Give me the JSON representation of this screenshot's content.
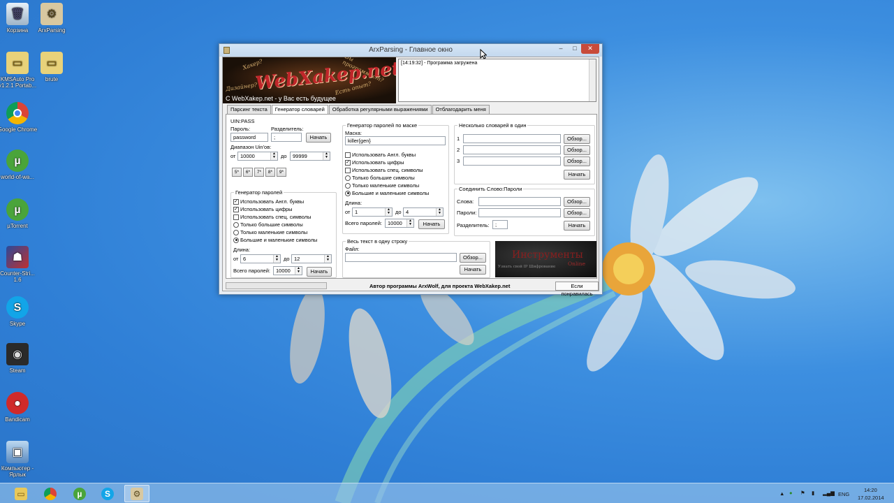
{
  "desktop_icons": [
    {
      "label": "Корзина"
    },
    {
      "label": "ArxParsing"
    },
    {
      "label": "KMSAuto Pro v1.2.1 Portab..."
    },
    {
      "label": "brute"
    },
    {
      "label": "Google Chrome"
    },
    {
      "label": "world-of-wa..."
    },
    {
      "label": "µTorrent"
    },
    {
      "label": "Counter-Stri... 1.6"
    },
    {
      "label": "Skype"
    },
    {
      "label": "Steam"
    },
    {
      "label": "Bandicam"
    },
    {
      "label": "Компьютер - Ярлык"
    }
  ],
  "window": {
    "title": "ArxParsing - Главное окно",
    "minimize": "–",
    "maximize": "□",
    "close": "✕"
  },
  "banner": {
    "logo": "WebXakep.net",
    "deco1": "Хакер?",
    "deco2": "Вы программист?",
    "deco3": "Дизайнер?",
    "deco4": "Есть опыт?",
    "subtitle": "С WebXakep.net - у Вас есть будущее"
  },
  "log": {
    "line": "[14:19:32] - Программа загружена"
  },
  "tabs": [
    "Парсинг текста",
    "Генератор словарей",
    "Обработка регулярными выражениями",
    "Отблагодарить меня"
  ],
  "uinpass": {
    "title": "UIN:PASS",
    "password_label": "Пароль:",
    "password_value": "password",
    "separator_label": "Разделитель:",
    "separator_value": ";",
    "start": "Начать",
    "range_label": "Диапазон Uin'ов:",
    "from_label": "от",
    "from_value": "10000",
    "to_label": "до",
    "to_value": "99999",
    "digit_buttons": [
      "5*",
      "6*",
      "7*",
      "8*",
      "9*"
    ]
  },
  "passgen": {
    "title": "Генератор паролей",
    "options": [
      {
        "label": "Использовать Англ. буквы",
        "type": "check",
        "on": true
      },
      {
        "label": "Использовать цифры",
        "type": "check",
        "on": true
      },
      {
        "label": "Использовать спец. символы",
        "type": "check",
        "on": false
      },
      {
        "label": "Только большие символы",
        "type": "radio",
        "on": false
      },
      {
        "label": "Только маленькие символы",
        "type": "radio",
        "on": false
      },
      {
        "label": "Большие и маленькие символы",
        "type": "radio",
        "on": true
      }
    ],
    "length_label": "Длина:",
    "from_label": "от",
    "from_value": "6",
    "to_label": "до",
    "to_value": "12",
    "total_label": "Всего паролей:",
    "total_value": "10000",
    "start": "Начать"
  },
  "maskgen": {
    "title": "Генератор паролей по маске",
    "mask_label": "Маска:",
    "mask_value": "killer{gen}",
    "options": [
      {
        "label": "Использовать Англ. буквы",
        "type": "check",
        "on": false
      },
      {
        "label": "Использовать цифры",
        "type": "check",
        "on": true
      },
      {
        "label": "Использовать спец. символы",
        "type": "check",
        "on": false
      },
      {
        "label": "Только большие символы",
        "type": "radio",
        "on": false
      },
      {
        "label": "Только маленькие символы",
        "type": "radio",
        "on": false
      },
      {
        "label": "Большие и маленькие символы",
        "type": "radio",
        "on": true
      }
    ],
    "length_label": "Длина:",
    "from_label": "от",
    "from_value": "1",
    "to_label": "до",
    "to_value": "4",
    "total_label": "Всего паролей:",
    "total_value": "10000",
    "start": "Начать"
  },
  "oneline": {
    "title": "Весь текст в одну строку",
    "file_label": "Файл:",
    "browse": "Обзор...",
    "start": "Начать"
  },
  "merge": {
    "title": "Несколько словарей в один",
    "rows": [
      "1",
      "2",
      "3"
    ],
    "browse": "Обзор...",
    "start": "Начать"
  },
  "join": {
    "title": "Соединить Слово:Пароли",
    "words_label": "Слова:",
    "passwords_label": "Пароли:",
    "separator_label": "Разделитель:",
    "separator_value": ";",
    "browse": "Обзор...",
    "start": "Начать"
  },
  "instruments": {
    "title": "Инструменты",
    "online": "Online",
    "small": "Узнать свой IP Шифрование"
  },
  "status": {
    "author": "Автор программы ArxWolf, для проекта WebXakep.net",
    "thanks": "Если понравилась"
  },
  "taskbar": {
    "lang": "ENG",
    "time": "14:20",
    "date": "17.02.2014"
  },
  "colors": {
    "desktop": "#2f7fd6",
    "close_button": "#c84b3a"
  }
}
